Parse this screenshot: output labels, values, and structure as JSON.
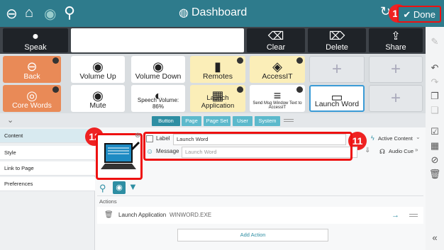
{
  "topbar": {
    "title": "Dashboard",
    "done_label": "Done",
    "badge_done": "13"
  },
  "messagebar": {
    "speak_label": "Speak",
    "clear_label": "Clear",
    "delete_label": "Delete",
    "share_label": "Share"
  },
  "grid": {
    "row1": [
      {
        "label": "Back"
      },
      {
        "label": "Volume Up"
      },
      {
        "label": "Volume Down"
      },
      {
        "label": "Remotes"
      },
      {
        "label": "AccessIT"
      }
    ],
    "row2": [
      {
        "label": "Core Words"
      },
      {
        "label": "Mute"
      },
      {
        "label": "Speech Volume: 86%"
      },
      {
        "label": "Launch Application"
      },
      {
        "label": "Send Msg Window Text to AccessIT"
      },
      {
        "label": "Launch Word"
      }
    ]
  },
  "tabs": [
    "Button",
    "Page",
    "Page Set",
    "User",
    "System"
  ],
  "side": [
    "Content",
    "Style",
    "Link to Page",
    "Preferences"
  ],
  "editor": {
    "badge_preview": "12",
    "badge_label": "11",
    "label_caption": "Label",
    "label_value": "Launch Word",
    "message_caption": "Message",
    "message_placeholder": "Launch Word",
    "active_content": "Active Content",
    "audio_cue": "Audio Cue",
    "actions_heading": "Actions",
    "action_name": "Launch Application",
    "action_detail": "WINWORD.EXE",
    "add_action": "Add Action"
  }
}
